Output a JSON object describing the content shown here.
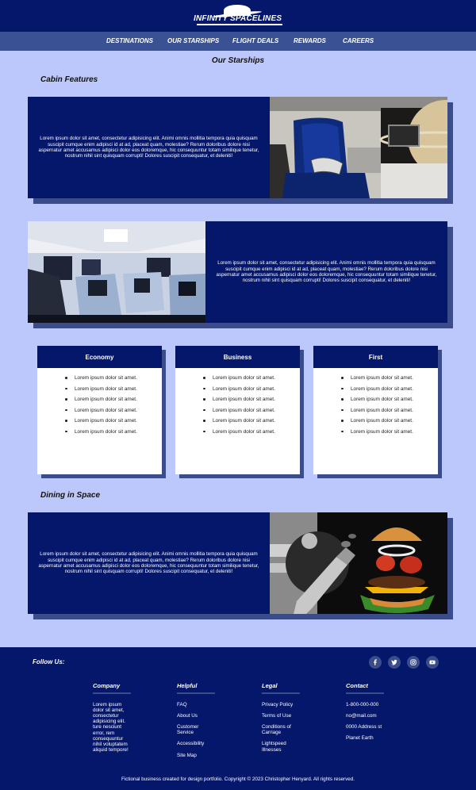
{
  "brand": {
    "name": "INFINITY SPACELINES"
  },
  "nav": {
    "items": [
      "DESTINATIONS",
      "OUR STARSHIPS",
      "FLIGHT DEALS",
      "REWARDS",
      "CAREERS"
    ]
  },
  "page": {
    "title": "Our Starships"
  },
  "sections": {
    "cabin_title": "Cabin Features",
    "dining_title": "Dining in Space"
  },
  "features": [
    {
      "text": "Lorem ipsum dolor sit amet, consectetur adipisicing elit. Animi omnis mollitia tempora quia quisquam suscipit cumque enim adipisci id at ad, placeat quam, molestiae? Rerum doloribus dolore nisi aspernatur amet accusamus adipisci dolor eos doloremque, hic consequuntur totam similique tenetur, nostrum nihil sint quisquam corrupti! Dolores suscipit consequatur, et deleniti!"
    },
    {
      "text": "Lorem ipsum dolor sit amet, consectetur adipisicing elit. Animi omnis mollitia tempora quia quisquam suscipit cumque enim adipisci id at ad, placeat quam, molestiae? Rerum doloribus dolore nisi aspernatur amet accusamus adipisci dolor eos doloremque, hic consequuntur totam similique tenetur, nostrum nihil sint quisquam corrupti! Dolores suscipit consequatur, et deleniti!"
    },
    {
      "text": "Lorem ipsum dolor sit amet, consectetur adipisicing elit. Animi omnis mollitia tempora quia quisquam suscipit cumque enim adipisci id at ad, placeat quam, molestiae? Rerum doloribus dolore nisi aspernatur amet accusamus adipisci dolor eos doloremque, hic consequuntur totam similique tenetur, nostrum nihil sint quisquam corrupti! Dolores suscipit consequatur, et deleniti!"
    }
  ],
  "classes": [
    {
      "name": "Economy",
      "items": [
        "Lorem ipsum dolor sit amet.",
        "Lorem ipsum dolor sit amet.",
        "Lorem ipsum dolor sit amet.",
        "Lorem ipsum dolor sit amet.",
        "Lorem ipsum dolor sit amet.",
        "Lorem ipsum dolor sit amet."
      ]
    },
    {
      "name": "Business",
      "items": [
        "Lorem ipsum dolor sit amet.",
        "Lorem ipsum dolor sit amet.",
        "Lorem ipsum dolor sit amet.",
        "Lorem ipsum dolor sit amet.",
        "Lorem ipsum dolor sit amet.",
        "Lorem ipsum dolor sit amet."
      ]
    },
    {
      "name": "First",
      "items": [
        "Lorem ipsum dolor sit amet.",
        "Lorem ipsum dolor sit amet.",
        "Lorem ipsum dolor sit amet.",
        "Lorem ipsum dolor sit amet.",
        "Lorem ipsum dolor sit amet.",
        "Lorem ipsum dolor sit amet."
      ]
    }
  ],
  "footer": {
    "follow_label": "Follow Us:",
    "social_icons": [
      "facebook-icon",
      "twitter-icon",
      "instagram-icon",
      "youtube-icon"
    ],
    "columns": [
      {
        "title": "Company",
        "items": [
          "Lorem ipsum dolor sit amet, consectetur adipisicing elit. ture nesciunt error, rem consequuntur nihil voluptatem aliquid tempore!"
        ]
      },
      {
        "title": "Helpful",
        "items": [
          "FAQ",
          "About Us",
          "Customer Service",
          "Accessibility",
          "Site Map"
        ]
      },
      {
        "title": "Legal",
        "items": [
          "Privacy Policy",
          "Terms of Use",
          "Conditions of Carriage",
          "Lightspeed Illnesses"
        ]
      },
      {
        "title": "Contact",
        "items": [
          "1-800-000-000",
          "no@mail.com",
          "0000 Address st",
          "Planet Earth"
        ]
      }
    ],
    "copyright": "Fictional business created for design portfolio. Copyright © 2023 Christopher Henyard. All rights reserved."
  },
  "colors": {
    "navy": "#04176a",
    "nav_bar": "#3a5294",
    "page_bg": "#bcc8fc",
    "shadow": "#3a4d8a"
  }
}
